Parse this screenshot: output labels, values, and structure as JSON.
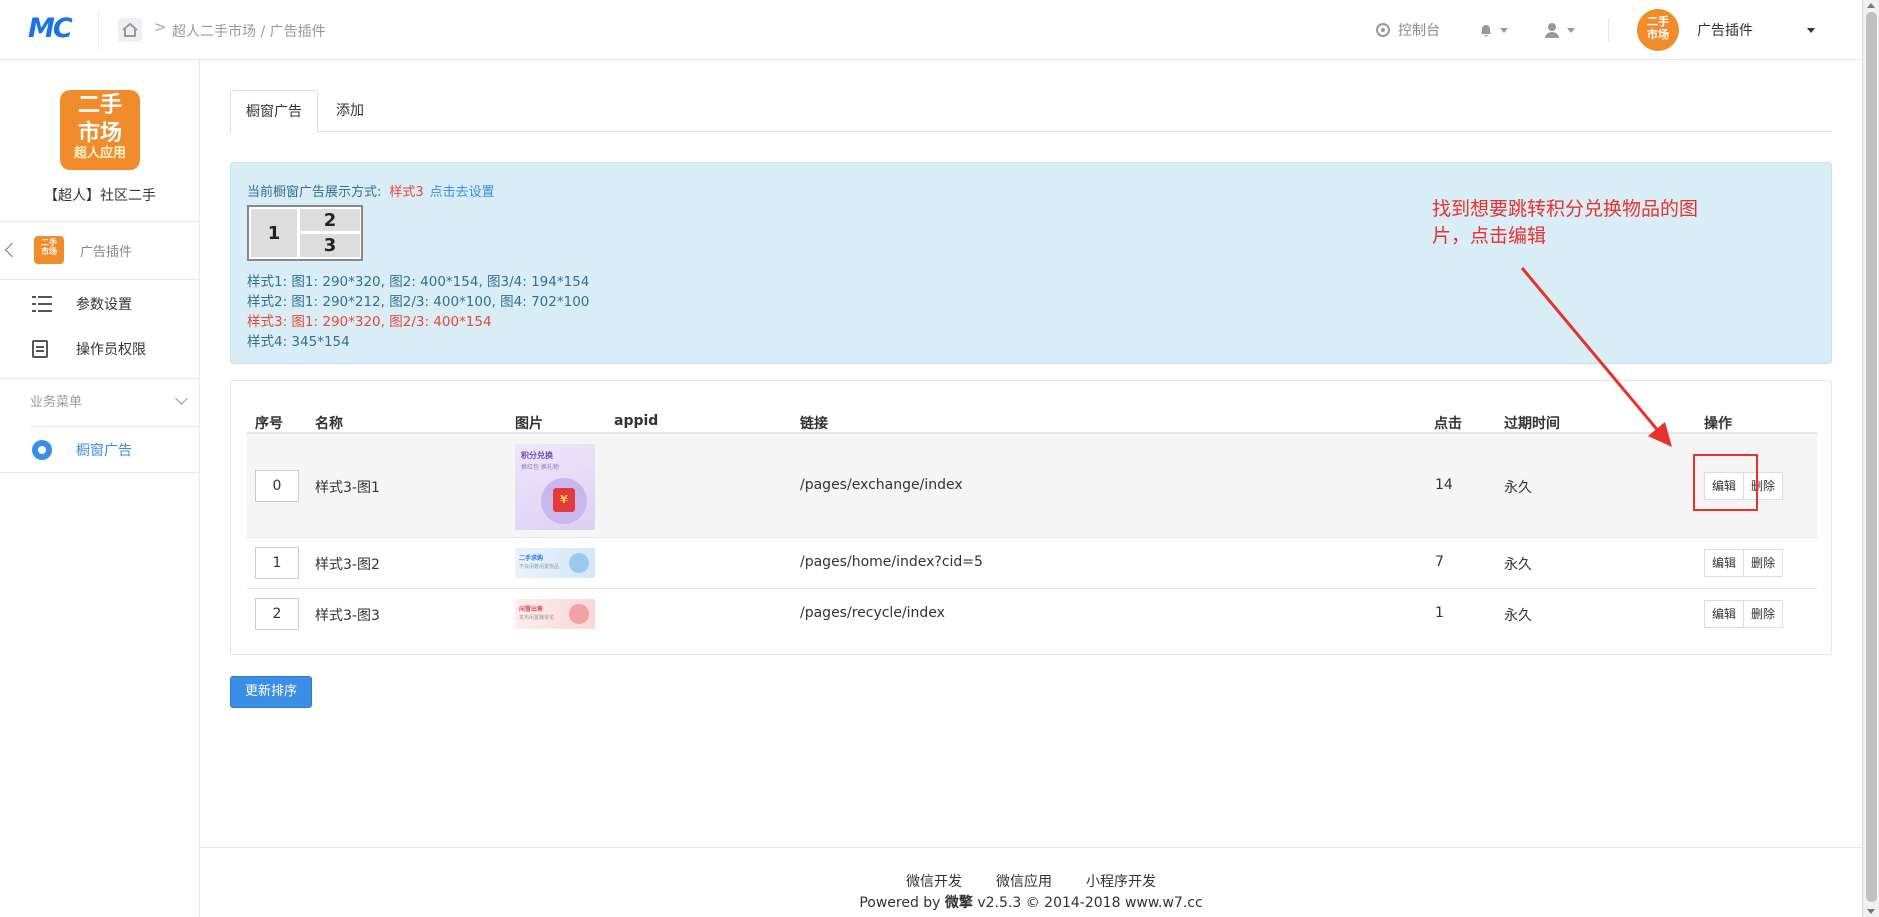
{
  "header": {
    "logo": "MC",
    "breadcrumb": "超人二手市场 / 广告插件",
    "breadcrumb_sep": ">",
    "console_label": "控制台",
    "account_avatar_text": "二手市场超人应用",
    "account_name": "广告插件"
  },
  "sidebar": {
    "app_logo_line1": "二手",
    "app_logo_line2": "市场",
    "app_logo_line3": "超人应用",
    "app_name": "【超人】社区二手",
    "plugin_icon_text": "二手市场",
    "plugin_label": "广告插件",
    "items": [
      {
        "label": "参数设置"
      },
      {
        "label": "操作员权限"
      }
    ],
    "section_label": "业务菜单",
    "active_item": "橱窗广告"
  },
  "tabs": [
    {
      "label": "橱窗广告"
    },
    {
      "label": "添加"
    }
  ],
  "info": {
    "current_prefix": "当前橱窗广告展示方式:",
    "current_style": "样式3",
    "set_link": "点击去设置",
    "cells": [
      "1",
      "2",
      "3"
    ],
    "styles": [
      "样式1: 图1: 290*320, 图2: 400*154, 图3/4: 194*154",
      "样式2: 图1: 290*212, 图2/3: 400*100, 图4: 702*100",
      "样式3: 图1: 290*320, 图2/3: 400*154",
      "样式4: 345*154"
    ]
  },
  "table": {
    "headers": [
      "序号",
      "名称",
      "图片",
      "appid",
      "链接",
      "点击",
      "过期时间",
      "操作"
    ],
    "rows": [
      {
        "index": "0",
        "name": "样式3-图1",
        "appid": "",
        "link": "/pages/exchange/index",
        "clicks": "14",
        "expire": "永久"
      },
      {
        "index": "1",
        "name": "样式3-图2",
        "appid": "",
        "link": "/pages/home/index?cid=5",
        "clicks": "7",
        "expire": "永久"
      },
      {
        "index": "2",
        "name": "样式3-图3",
        "appid": "",
        "link": "/pages/recycle/index",
        "clicks": "1",
        "expire": "永久"
      }
    ],
    "edit_label": "编辑",
    "delete_label": "删除",
    "thumbs": {
      "big_title": "积分兑换",
      "big_sub": "换红包 换礼物",
      "big_symbol": "¥",
      "small1_title": "二手求购",
      "small1_sub": "不会闲着闲置物品",
      "small2_title": "闲置出售",
      "small2_sub": "发布闲置赚零花"
    }
  },
  "update_button": "更新排序",
  "annotation": "找到想要跳转积分兑换物品的图片，点击编辑",
  "footer": {
    "links": [
      "微信开发",
      "微信应用",
      "小程序开发"
    ],
    "copy_prefix": "Powered by ",
    "copy_brand": "微擎",
    "copy_suffix": " v2.5.3 © 2014-2018 www.w7.cc"
  },
  "colors": {
    "accent": "#3a8ee6",
    "brand_orange": "#f08c2b",
    "annotation_red": "#e8312b",
    "info_bg": "#d9edf7"
  }
}
